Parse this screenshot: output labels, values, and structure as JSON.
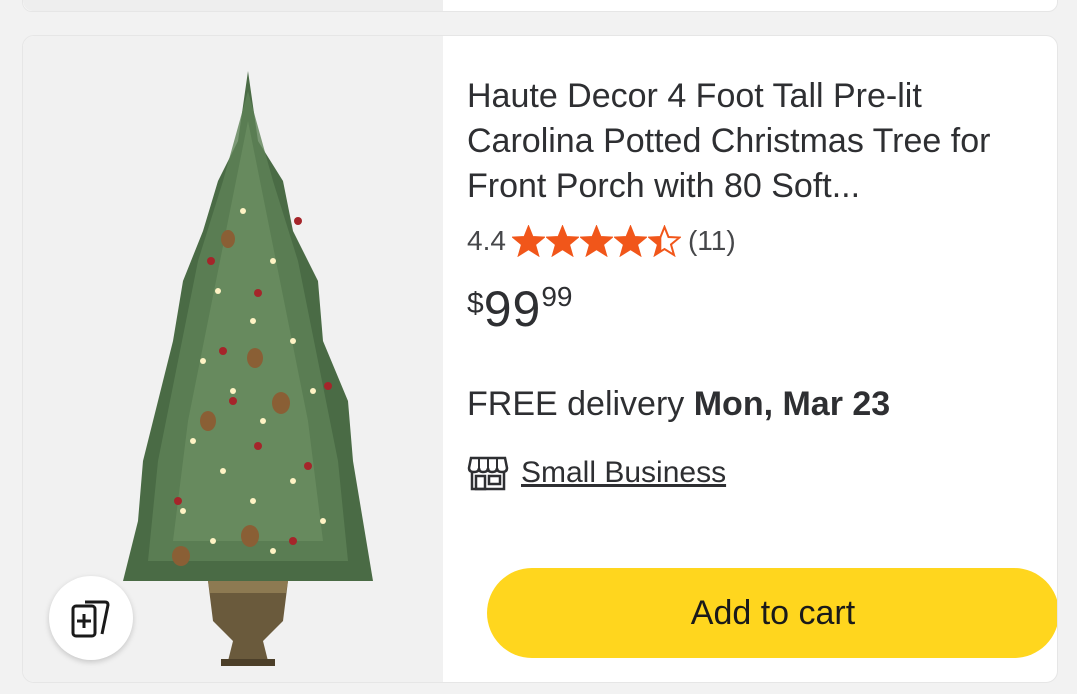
{
  "product": {
    "title": "Haute Decor 4 Foot Tall Pre-lit Carolina Potted Christmas Tree for Front Porch with 80 Soft...",
    "rating": "4.4",
    "rating_value": 4.4,
    "rating_max": 5,
    "review_count": "(11)",
    "price_currency": "$",
    "price_dollars": "99",
    "price_cents": "99",
    "delivery_prefix": "FREE delivery",
    "delivery_date": "Mon, Mar 23",
    "badge_label": "Small Business",
    "add_to_cart_label": "Add to cart",
    "image_icon": "christmas-tree-product-image",
    "compare_icon": "compare-add-icon",
    "badge_icon": "storefront-icon"
  },
  "colors": {
    "accent_button": "#ffd61e",
    "star": "#f1561a",
    "text": "#2e2f32"
  }
}
